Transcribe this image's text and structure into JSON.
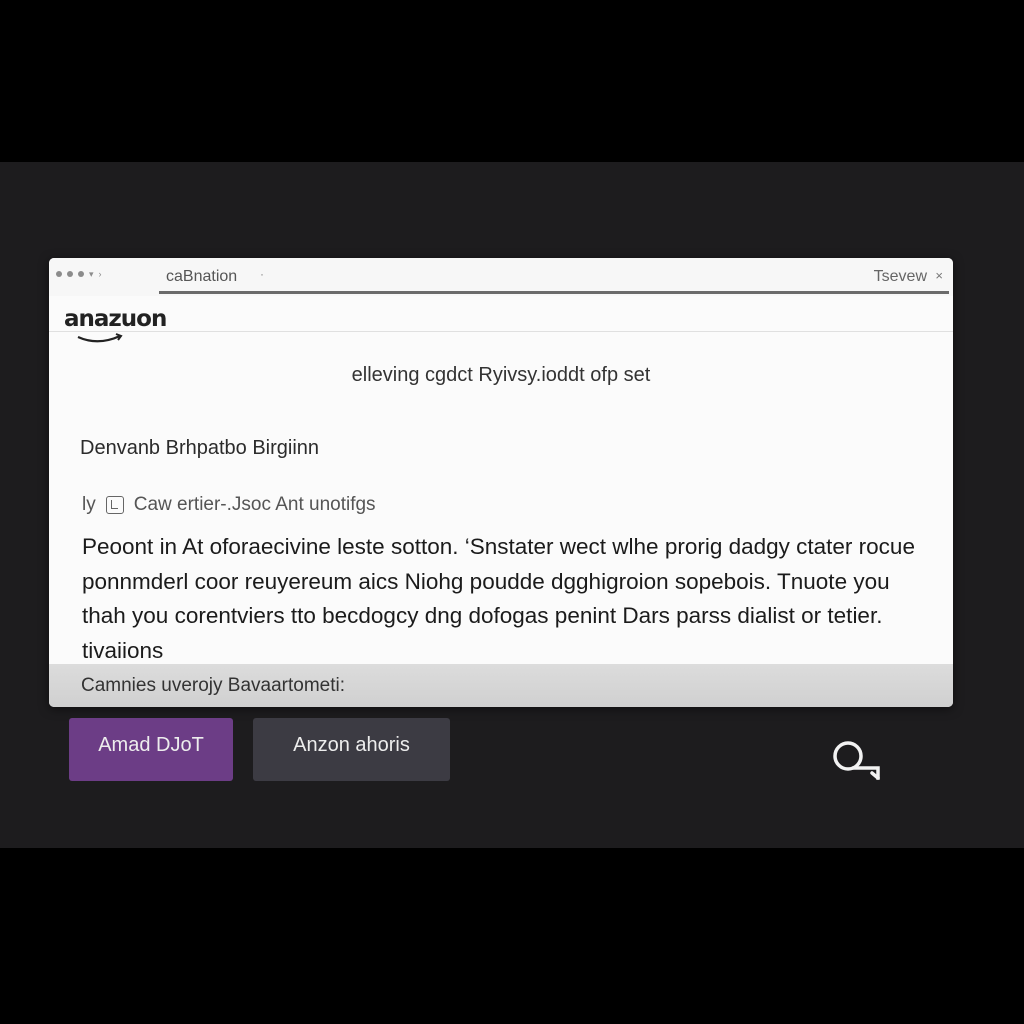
{
  "window": {
    "tab_label": "caBnation",
    "tab_caret": "·",
    "right_label": "Tsevew",
    "close_glyph": "×"
  },
  "logo": {
    "text": "anazuon"
  },
  "article": {
    "heading": "elleving cgdct Ryivsy.ioddt ofp set",
    "author": "Denvanb Brhpatbo Birgiinn",
    "meta_prefix": "ly",
    "meta_text": "Caw ertier-.Jsoc Ant unotifgs",
    "body": "Peoont in At oforaecivine leste sotton. ‘Snstater wect wlhe prorig dadgy ctater rocue ponnmderl coor reuyereum aics Niohg poudde dgghigroion sopebois. Tnuote you thah you corentviers tto becdogcy dng dofogas penint Dars parss dialist or tetier. tivaiions"
  },
  "footer": {
    "text": "Camnies uverojy Bavaartometi:"
  },
  "buttons": {
    "primary_label": "Amad DJoT",
    "secondary_label": "Anzon ahoris"
  },
  "colors": {
    "primary_button": "#6c3d86",
    "secondary_button": "#3c3b43",
    "stage_background": "#1d1c1e"
  },
  "icons": {
    "search": "search-icon"
  }
}
